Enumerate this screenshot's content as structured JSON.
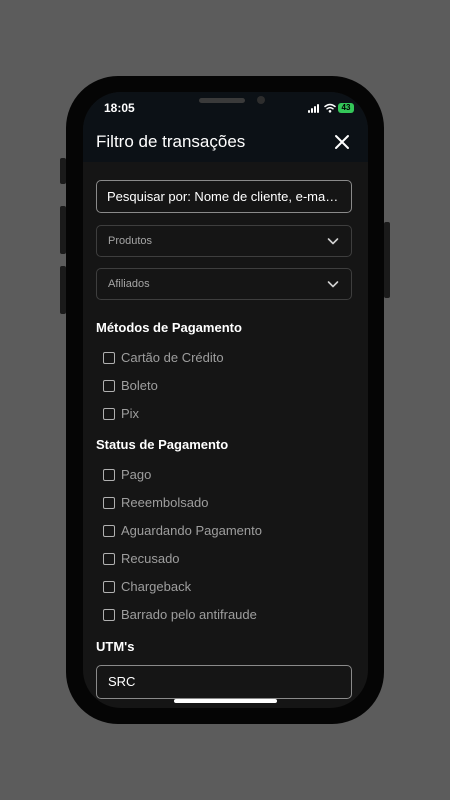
{
  "status_bar": {
    "time": "18:05",
    "battery": "43"
  },
  "header": {
    "title": "Filtro de transações",
    "close_icon": "close-icon"
  },
  "search": {
    "placeholder": "Pesquisar por: Nome de cliente, e-mail, t..."
  },
  "filters": {
    "produtos_label": "Produtos",
    "afiliados_label": "Afiliados"
  },
  "payment_methods": {
    "title": "Métodos de Pagamento",
    "options": [
      "Cartão de Crédito",
      "Boleto",
      "Pix"
    ]
  },
  "payment_status": {
    "title": "Status de Pagamento",
    "options": [
      "Pago",
      "Reeembolsado",
      "Aguardando Pagamento",
      "Recusado",
      "Chargeback",
      "Barrado pelo antifraude"
    ]
  },
  "utm": {
    "title": "UTM's",
    "value": "SRC"
  },
  "colors": {
    "background": "#5c5c5c",
    "screen": "#151515",
    "header": "#0c1116",
    "battery": "#34c759"
  }
}
